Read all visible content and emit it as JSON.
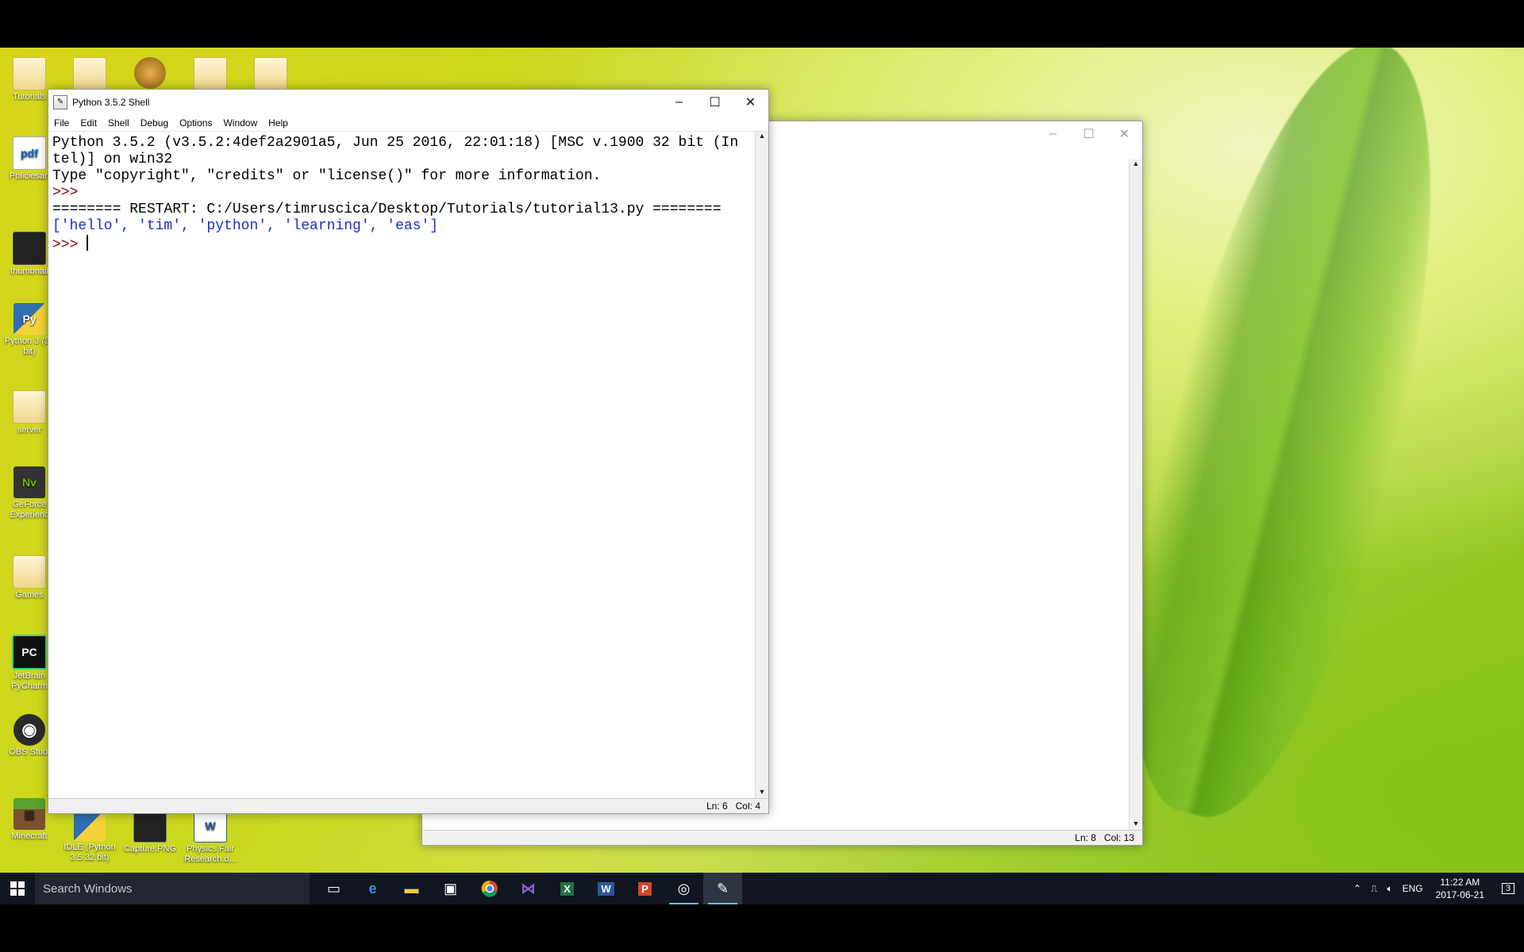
{
  "desktop": {
    "icons_left": [
      {
        "name": "Tutorials",
        "glyph": ""
      },
      {
        "name": "Policiesan",
        "glyph": "pdf"
      },
      {
        "name": "thumbnail",
        "glyph": ""
      },
      {
        "name": "Python 3 (32 bit)",
        "glyph": "Py"
      },
      {
        "name": "server",
        "glyph": ""
      },
      {
        "name": "GeForce Experienc",
        "glyph": "Nv"
      },
      {
        "name": "Games",
        "glyph": ""
      },
      {
        "name": "JetBrain PyCharm",
        "glyph": "PC"
      },
      {
        "name": "OBS Studi",
        "glyph": "◉"
      },
      {
        "name": "Minecraft",
        "glyph": "▦"
      }
    ],
    "icons_bottom": [
      {
        "name": "IDLE (Python 3.5 32 bit)"
      },
      {
        "name": "Capture.PNG"
      },
      {
        "name": "Physics Fair Research.d..."
      }
    ]
  },
  "shell_window": {
    "title": "Python 3.5.2 Shell",
    "menu": [
      "File",
      "Edit",
      "Shell",
      "Debug",
      "Options",
      "Window",
      "Help"
    ],
    "lines": {
      "banner1": "Python 3.5.2 (v3.5.2:4def2a2901a5, Jun 25 2016, 22:01:18) [MSC v.1900 32 bit (In",
      "banner2": "tel)] on win32",
      "banner3": "Type \"copyright\", \"credits\" or \"license()\" for more information.",
      "prompt1": ">>> ",
      "restart": "======== RESTART: C:/Users/timruscica/Desktop/Tutorials/tutorial13.py ========",
      "result": "['hello', 'tim', 'python', 'learning', 'eas']",
      "prompt2": ">>> "
    },
    "status": {
      "line": "Ln: 6",
      "col": "Col: 4"
    }
  },
  "editor_window": {
    "status": {
      "line": "Ln: 8",
      "col": "Col: 13"
    }
  },
  "taskbar": {
    "search_placeholder": "Search Windows",
    "apps": [
      {
        "icon": "task-view-icon"
      },
      {
        "icon": "edge-icon"
      },
      {
        "icon": "file-explorer-icon"
      },
      {
        "icon": "store-icon"
      },
      {
        "icon": "chrome-icon"
      },
      {
        "icon": "visual-studio-icon"
      },
      {
        "icon": "excel-icon"
      },
      {
        "icon": "word-icon"
      },
      {
        "icon": "powerpoint-icon"
      },
      {
        "icon": "obs-icon"
      },
      {
        "icon": "idle-icon"
      }
    ],
    "tray": {
      "language": "ENG",
      "time": "11:22 AM",
      "date": "2017-06-21",
      "notifications": "3"
    }
  },
  "colors": {
    "prompt": "#8b0000",
    "result": "#1530c8",
    "taskbar": "#0f1620"
  }
}
